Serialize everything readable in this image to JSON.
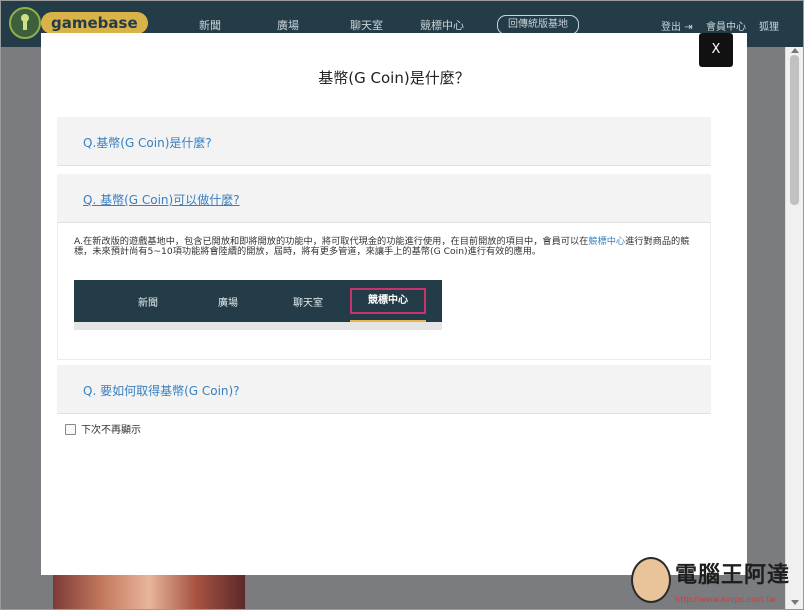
{
  "site": {
    "logo_text": "gamebase",
    "nav": [
      "新聞",
      "廣場",
      "聊天室",
      "競標中心"
    ],
    "nav_button": "回傳統版基地",
    "logout": "登出",
    "member_center": "會員中心",
    "extra": "狐狸"
  },
  "modal": {
    "title": "基幣(G Coin)是什麼？",
    "close_label": "X",
    "faqs": [
      {
        "question": "Q.基幣(G Coin)是什麼?"
      },
      {
        "question": "Q. 基幣(G Coin)可以做什麼?"
      },
      {
        "question": "Q. 要如何取得基幣(G Coin)?"
      }
    ],
    "answer": {
      "part1": "A.在新改版的遊戲基地中，包含已開放和即將開放的功能中，將可取代現金的功能進行使用，在目前開放的項目中，會員可以在",
      "link": "競標中心",
      "part2": "進行對商品的競標，未來預計尚有5~10項功能將會陸續的開放，屆時，將有更多管道，來讓手上的基幣(G Coin)進行有效的應用。"
    },
    "demo_nav": [
      "新聞",
      "廣場",
      "聊天室",
      "競標中心"
    ],
    "checkbox_label": "下次不再顯示"
  },
  "watermark": {
    "text": "電腦王阿達",
    "url": "http://www.kocpc.com.tw"
  },
  "colors": {
    "topbar": "#233c47",
    "link": "#3a7fc0",
    "highlight_border": "#c9336d",
    "active_underline": "#e7b84a"
  }
}
